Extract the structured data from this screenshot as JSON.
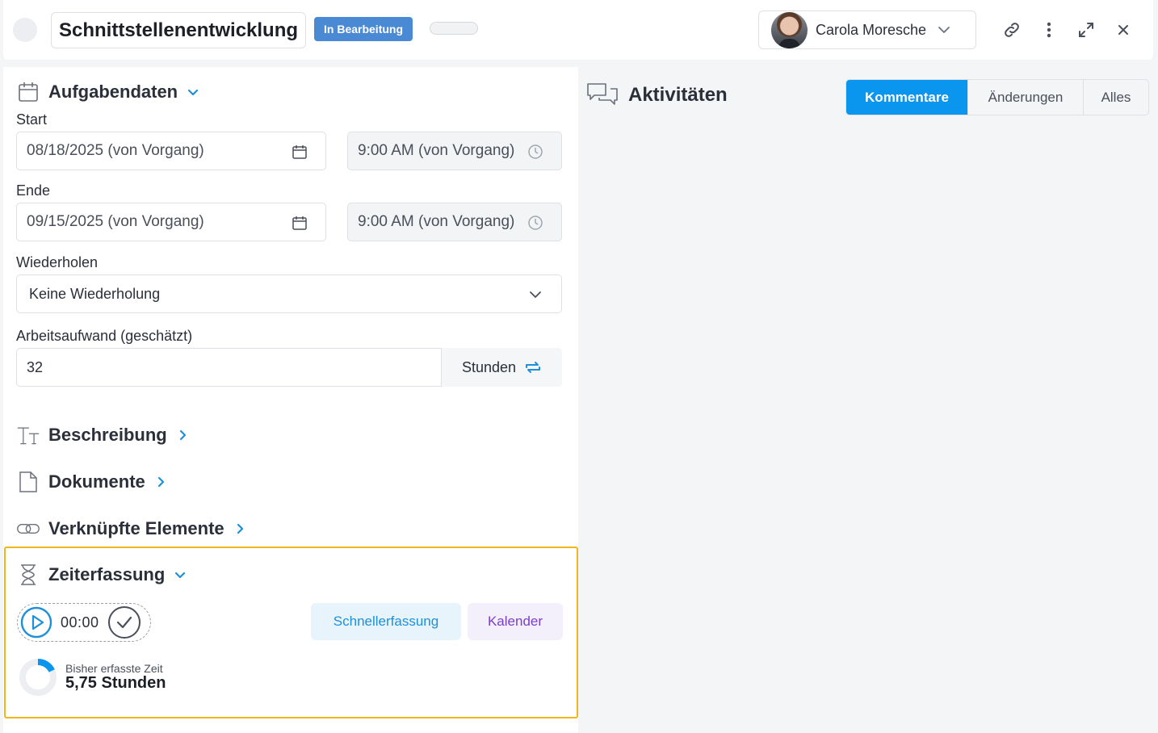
{
  "header": {
    "task_title": "Schnittstellenentwicklung",
    "status": "In Bearbeitung",
    "assignee": "Carola Moresche",
    "icons": [
      "link-icon",
      "more-vertical-icon",
      "expand-icon",
      "close-icon"
    ]
  },
  "task_data": {
    "section_title": "Aufgabendaten",
    "start_label": "Start",
    "start_date": "08/18/2025 (von Vorgang)",
    "start_time": "9:00 AM (von Vorgang)",
    "end_label": "Ende",
    "end_date": "09/15/2025 (von Vorgang)",
    "end_time": "9:00 AM (von Vorgang)",
    "repeat_label": "Wiederholen",
    "repeat_value": "Keine Wiederholung",
    "effort_label": "Arbeitsaufwand (geschätzt)",
    "effort_value": "32",
    "effort_unit": "Stunden"
  },
  "sections": {
    "description": "Beschreibung",
    "documents": "Dokumente",
    "linked": "Verknüpfte Elemente"
  },
  "time_tracking": {
    "title": "Zeiterfassung",
    "timer_value": "00:00",
    "quick_entry_label": "Schnellerfassung",
    "calendar_label": "Kalender",
    "spent_label": "Bisher erfasste Zeit",
    "spent_value": "5,75 Stunden",
    "spent_progress_fraction": 0.18
  },
  "activities": {
    "title": "Aktivitäten",
    "tabs": [
      {
        "label": "Kommentare",
        "active": true
      },
      {
        "label": "Änderungen",
        "active": false
      },
      {
        "label": "Alles",
        "active": false
      }
    ]
  },
  "colors": {
    "accent": "#0a96ee",
    "status_badge": "#4a8ad4",
    "highlight_border": "#f2b51d",
    "calendar_text": "#7a3fc9"
  }
}
